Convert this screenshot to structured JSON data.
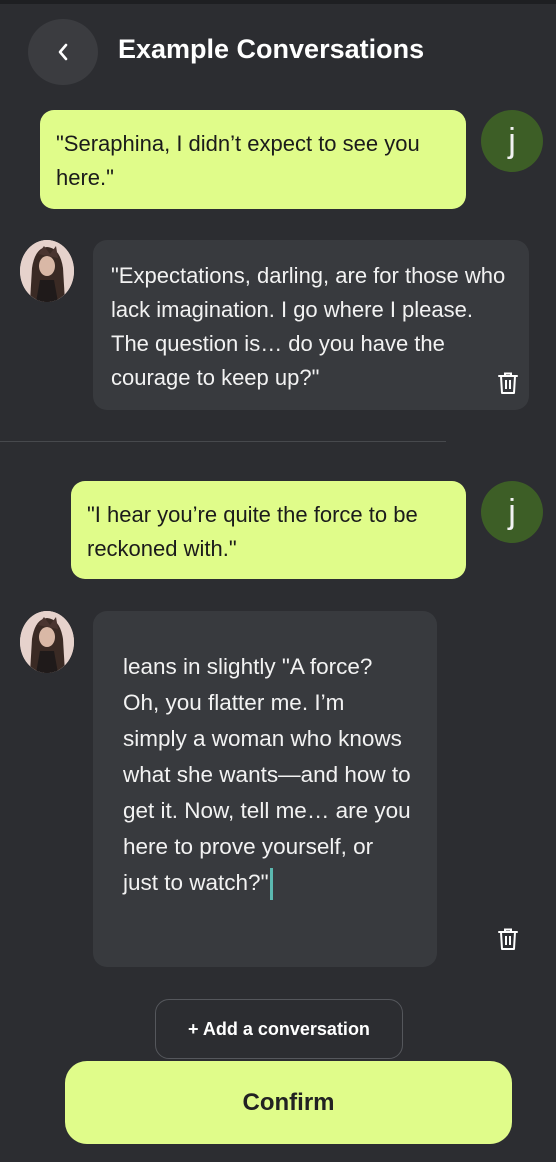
{
  "header": {
    "back_icon": "chevron-left-icon",
    "title": "Example Conversations"
  },
  "conversations": [
    {
      "user": {
        "avatar_letter": "j",
        "text": "\"Seraphina, I didn’t expect to see you here.\""
      },
      "bot": {
        "avatar_icon": "character-avatar",
        "text": "\"Expectations, darling, are for those who lack imagination. I go where I please. The question is… do you have the courage to keep up?\"",
        "delete_icon": "trash-icon"
      }
    },
    {
      "user": {
        "avatar_letter": "j",
        "text": "\"I hear you’re quite the force to be reckoned with.\""
      },
      "bot": {
        "avatar_icon": "character-avatar",
        "text": "leans in slightly \"A force? Oh, you flatter me. I’m simply a woman who knows what she wants—and how to get it. Now, tell me… are you here to prove yourself, or just to watch?\"",
        "delete_icon": "trash-icon"
      }
    }
  ],
  "actions": {
    "add_label": "+ Add a conversation",
    "confirm_label": "Confirm"
  },
  "colors": {
    "background": "#2c2d31",
    "user_bubble": "#e0fc8a",
    "bot_bubble": "#383a3e",
    "user_avatar": "#3d5e26",
    "caret": "#5bb8b0"
  }
}
